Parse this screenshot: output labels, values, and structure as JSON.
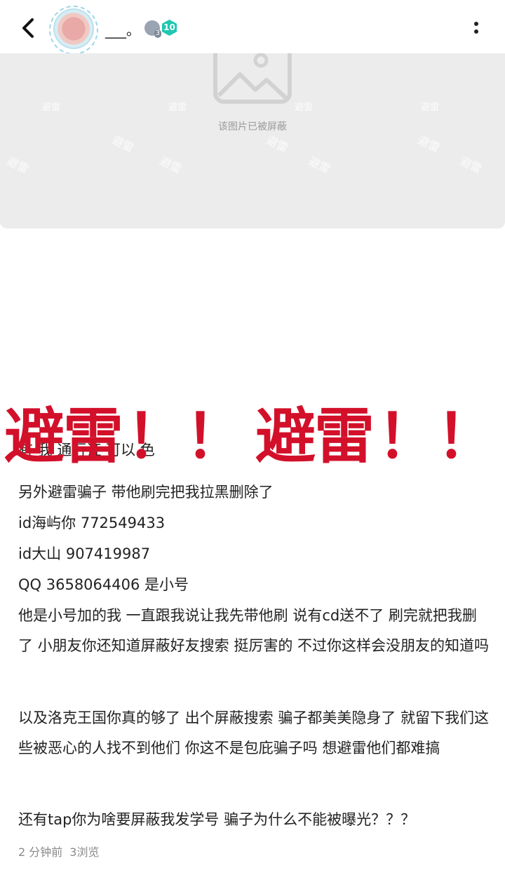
{
  "header": {
    "username": "___。",
    "badge_count": "3",
    "level": "10"
  },
  "blocked_image": {
    "notice": "该图片已被屏蔽",
    "watermark": "避雷"
  },
  "banner": {
    "word": "避雷",
    "marks": "！！"
  },
  "post": {
    "partial_line": "有  我  通行证  可以  色",
    "p1": "另外避雷骗子 带他刷完把我拉黑删除了",
    "p2": "id海屿你 772549433",
    "p3": "id大山 907419987",
    "p4": "QQ 3658064406 是小号",
    "p5": "他是小号加的我 一直跟我说让我先带他刷 说有cd送不了 刷完就把我删了 小朋友你还知道屏蔽好友搜索 挺厉害的  不过你这样会没朋友的知道吗",
    "p6": "以及洛克王国你真的够了 出个屏蔽搜索 骗子都美美隐身了 就留下我们这些被恶心的人找不到他们 你这不是包庇骗子吗 想避雷他们都难搞",
    "p7": "还有tap你为啥要屏蔽我发学号 骗子为什么不能被曝光？？？"
  },
  "meta": {
    "time": "2 分钟前",
    "views": "3浏览"
  },
  "icons": [
    "back-arrow-icon",
    "more-dots-icon",
    "image-placeholder-icon"
  ],
  "colors": {
    "banner_red": "#d3102a",
    "level_badge": "#1fc7b0"
  }
}
